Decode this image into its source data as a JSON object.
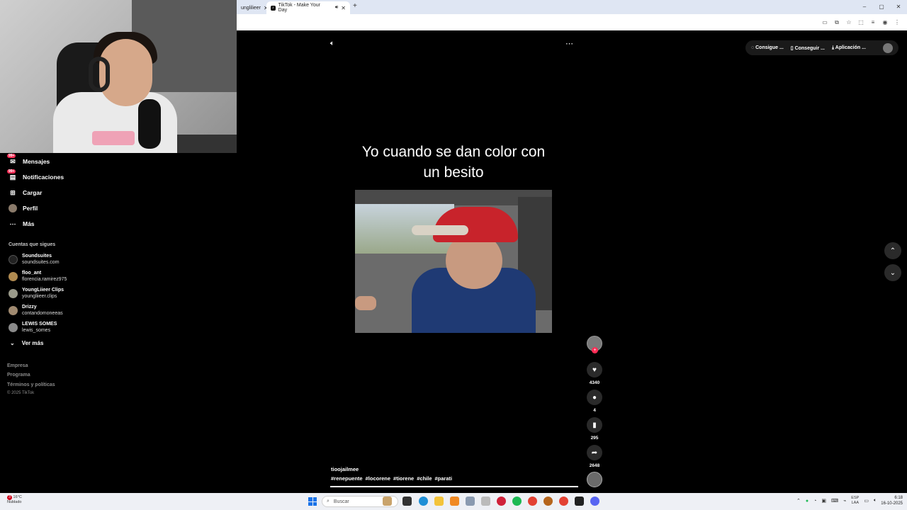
{
  "browser": {
    "inactive_tab_title": "unglilieer",
    "active_tab_title": "TikTok - Make Your Day",
    "new_tab_label": "+",
    "window_controls": [
      "–",
      "▢",
      "✕"
    ]
  },
  "sidebar": {
    "nav": [
      {
        "label": "Mensajes",
        "badge": "99+"
      },
      {
        "label": "Notificaciones",
        "badge": "99+"
      },
      {
        "label": "Cargar"
      },
      {
        "label": "Perfil"
      },
      {
        "label": "Más"
      }
    ],
    "following_title": "Cuentas que sigues",
    "following": [
      {
        "name": "Soundsuites",
        "handle": "soundsuites.com"
      },
      {
        "name": "floo_ant",
        "handle": "florencia.ramirez975"
      },
      {
        "name": "YoungLiieer Clips",
        "handle": "youngliieer.clips"
      },
      {
        "name": "Drizzy",
        "handle": "contandomoneeas"
      },
      {
        "name": "LEWIS SOMES",
        "handle": "lewis_somes"
      }
    ],
    "see_more": "Ver más",
    "footer_links": [
      "Empresa",
      "Programa",
      "Términos y políticas"
    ],
    "copyright": "© 2025 TikTok"
  },
  "video": {
    "caption_line1": "Yo cuando se dan color con",
    "caption_line2": "un besito",
    "author": "tioojailmee",
    "hashtags": [
      "#renepuente",
      "#locorene",
      "#tiorene",
      "#chile",
      "#parati"
    ],
    "likes": "4340",
    "comments": "4",
    "saves": "295",
    "shares": "2648",
    "progress": 1.0
  },
  "topbar": {
    "coins": "Consigue ...",
    "get_app": "Conseguir ...",
    "desktop_app": "Aplicación ..."
  },
  "taskbar": {
    "temperature": "16°C",
    "weather": "Nublado",
    "weather_badge": "3",
    "search_placeholder": "Buscar",
    "lang": "ESP",
    "region": "LAA",
    "time": "6:18",
    "date": "16-10-2025"
  }
}
